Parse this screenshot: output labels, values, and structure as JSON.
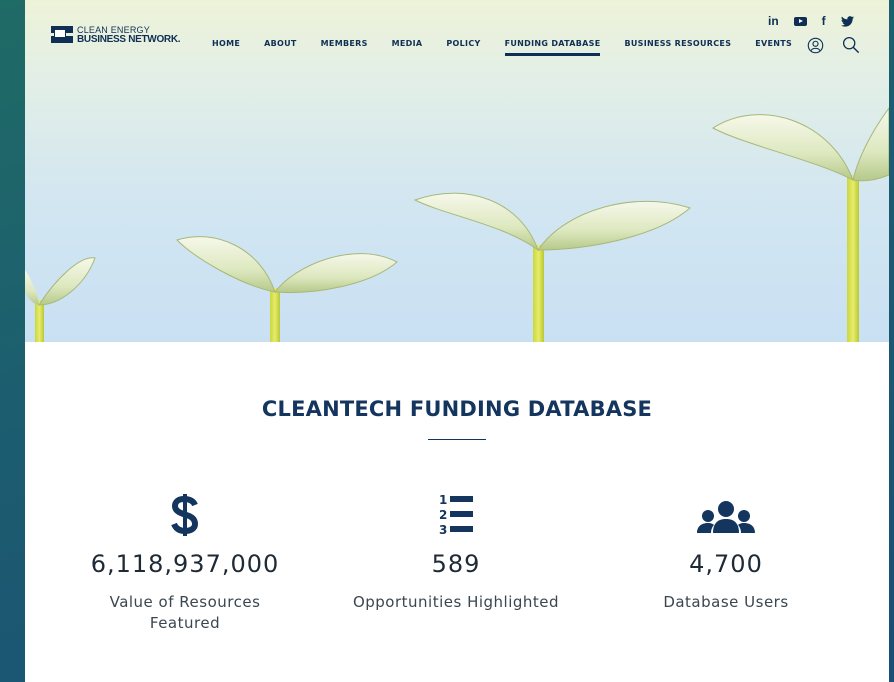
{
  "logo": {
    "line1": "CLEAN ENERGY",
    "line2": "BUSINESS NETWORK."
  },
  "nav": {
    "items": [
      {
        "label": "HOME"
      },
      {
        "label": "ABOUT"
      },
      {
        "label": "MEMBERS"
      },
      {
        "label": "MEDIA"
      },
      {
        "label": "POLICY"
      },
      {
        "label": "FUNDING DATABASE",
        "active": true
      },
      {
        "label": "BUSINESS RESOURCES"
      },
      {
        "label": "EVENTS"
      }
    ]
  },
  "social": {
    "linkedin": "in",
    "facebook": "f"
  },
  "icons": {
    "linkedin": "linkedin-icon",
    "youtube": "youtube-icon",
    "facebook": "facebook-icon",
    "twitter": "twitter-icon",
    "account": "user-account-icon",
    "search": "search-icon",
    "dollar": "dollar-icon",
    "list": "numbered-list-icon",
    "users": "users-group-icon"
  },
  "colors": {
    "brand_navy": "#0f2f55",
    "title": "#14355e",
    "page_bg": "#ffffff",
    "frame_bg": "#1c5c70"
  },
  "main": {
    "title": "CLEANTECH FUNDING DATABASE",
    "stats": [
      {
        "value": "6,118,937,000",
        "label": "Value of Resources Featured"
      },
      {
        "value": "589",
        "label": "Opportunities Highlighted"
      },
      {
        "value": "4,700",
        "label": "Database Users"
      }
    ]
  }
}
